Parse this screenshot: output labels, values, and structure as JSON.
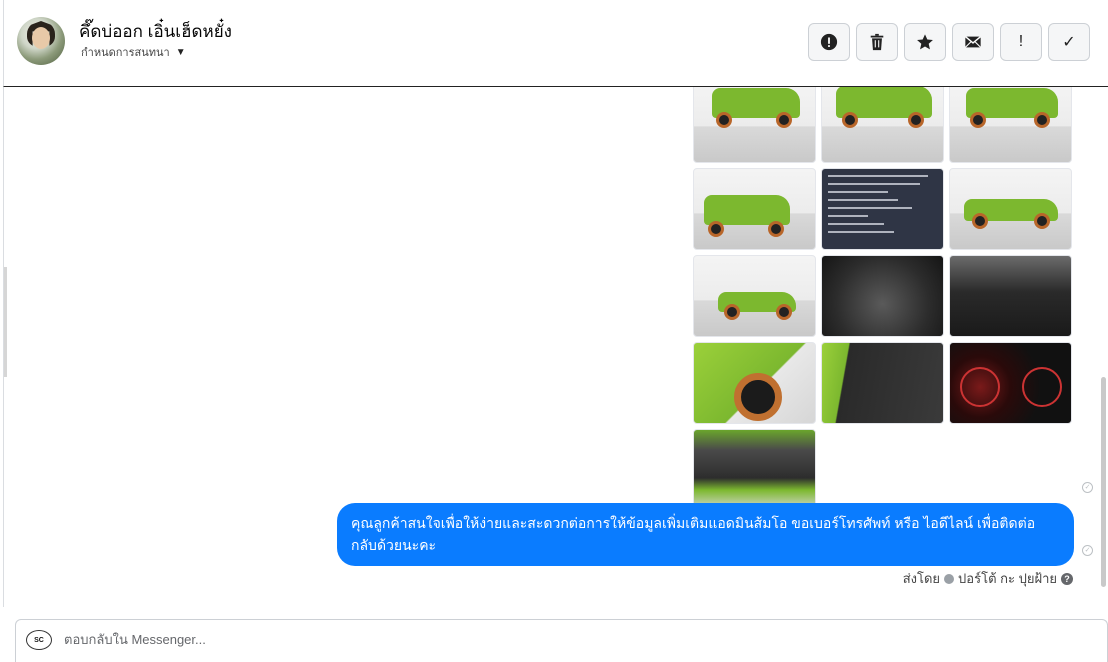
{
  "header": {
    "contact_name": "คึ๊ดบ่ออก เอิ๋นเฮ็ดหยั๋ง",
    "assign_label": "กำหนดการสนทนา",
    "actions": [
      {
        "name": "mark-spam-button",
        "icon": "alert-circle-icon"
      },
      {
        "name": "delete-button",
        "icon": "trash-icon"
      },
      {
        "name": "star-button",
        "icon": "star-icon"
      },
      {
        "name": "mark-unread-button",
        "icon": "envelope-icon"
      },
      {
        "name": "follow-up-button",
        "icon": "exclamation-icon",
        "glyph": "!"
      },
      {
        "name": "mark-done-button",
        "icon": "check-icon",
        "glyph": "✓"
      }
    ]
  },
  "thread": {
    "photos": [
      {
        "kind": "car-front"
      },
      {
        "kind": "car-front"
      },
      {
        "kind": "car-front"
      },
      {
        "kind": "car-rear"
      },
      {
        "kind": "document"
      },
      {
        "kind": "car-side"
      },
      {
        "kind": "car-side"
      },
      {
        "kind": "interior-gear"
      },
      {
        "kind": "interior-dash"
      },
      {
        "kind": "wheel"
      },
      {
        "kind": "door"
      },
      {
        "kind": "gauges"
      },
      {
        "kind": "engine"
      }
    ],
    "message_text": "คุณลูกค้าสนใจเพื่อให้ง่ายและสะดวกต่อการให้ข้อมูลเพิ่มเติมแอดมินส้มโอ ขอเบอร์โทรศัพท์ หรือ ไอดีไลน์ เพื่อติดต่อกลับด้วยนะคะ",
    "sent_by_label": "ส่งโดย",
    "sender_name": "ปอร์โต้ กะ ปุยฝ้าย",
    "bubble_color": "#0a7cff"
  },
  "reply": {
    "placeholder": "ตอบกลับใน Messenger...",
    "page_avatar_text": "SC"
  }
}
